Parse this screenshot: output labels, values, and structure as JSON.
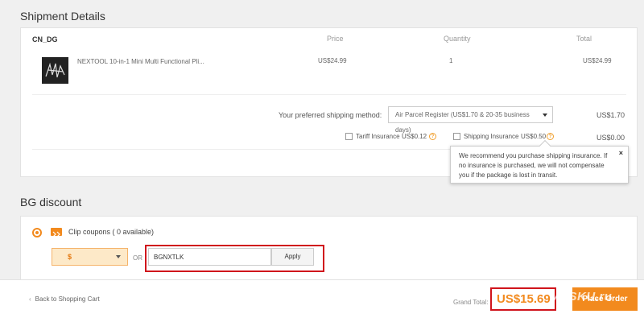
{
  "shipment": {
    "title": "Shipment Details",
    "warehouse": "CN_DG",
    "columns": {
      "price": "Price",
      "quantity": "Quantity",
      "total": "Total"
    },
    "item": {
      "name": "NEXTOOL 10-in-1 Mini Multi Functional Pli...",
      "price": "US$24.99",
      "quantity": "1",
      "total": "US$24.99"
    },
    "shipping_label": "Your preferred shipping method:",
    "shipping_value": "Air Parcel Register (US$1.70 & 20-35 business days)",
    "shipping_cost": "US$1.70",
    "tariff_label": "Tariff Insurance",
    "tariff_price": "US$0.12",
    "insurance_label": "Shipping Insurance",
    "insurance_price": "US$0.50",
    "insurance_total": "US$0.00",
    "tooltip": "We recommend you purchase shipping insurance. If no insurance is purchased, we will not compensate you if the package is lost in transit."
  },
  "discount": {
    "title": "BG discount",
    "coupons_label": "Clip coupons ( 0 available)",
    "currency_value": "$",
    "or_label": "OR",
    "code_value": "BGNXTLK",
    "apply_label": "Apply"
  },
  "footer": {
    "back_label": "Back to Shopping Cart",
    "grand_total_label": "Grand Total:",
    "grand_total_value": "US$15.69",
    "place_order_label": "Place Order"
  },
  "watermark": "MYSKU.ru",
  "colors": {
    "accent": "#f28a1e",
    "highlight": "#d0141c"
  }
}
